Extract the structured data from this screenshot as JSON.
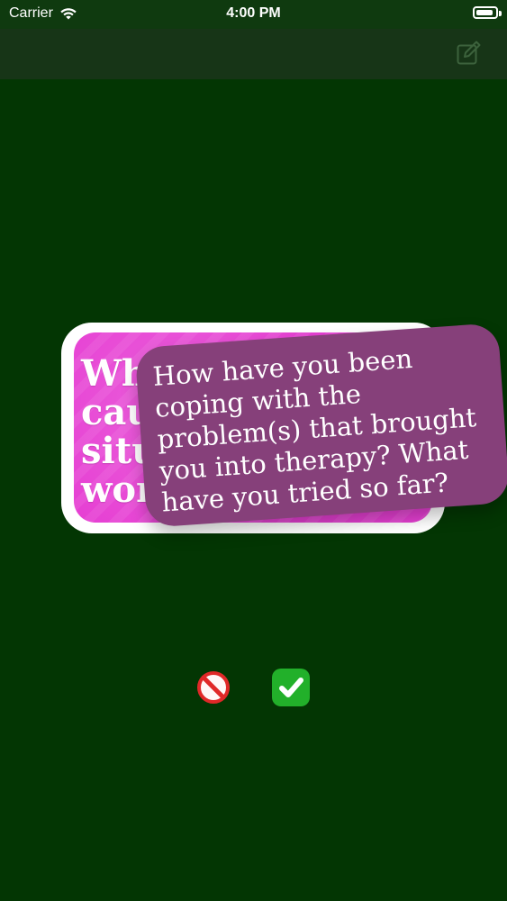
{
  "status_bar": {
    "carrier": "Carrier",
    "time": "4:00 PM"
  },
  "nav": {
    "compose_icon": "compose-icon"
  },
  "cards": {
    "back": {
      "text": "Wh\ncau\nsitu\nwor"
    },
    "front": {
      "text": "How have you been coping with the problem(s) that brought you into therapy? What have you tried so far?"
    }
  },
  "actions": {
    "no_icon": "no-entry-icon",
    "yes_icon": "check-mark-icon"
  },
  "colors": {
    "background": "#033603",
    "navbar": "#173517",
    "front_card": "#86407a",
    "back_card": "#e63fd3",
    "accent_green": "#22b02a"
  }
}
